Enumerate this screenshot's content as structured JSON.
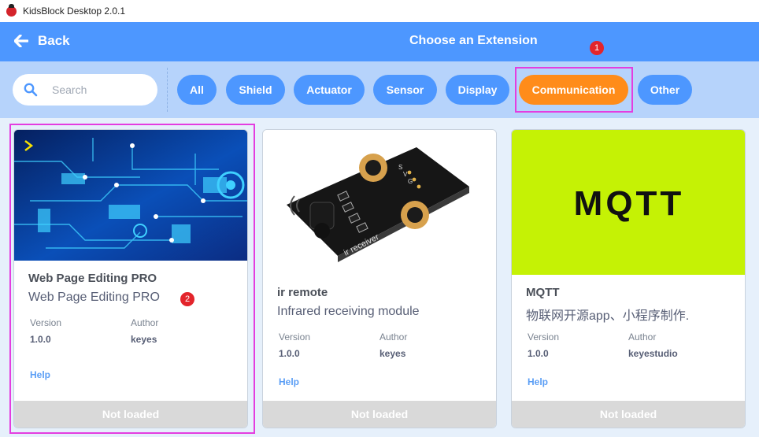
{
  "window": {
    "title": "KidsBlock Desktop 2.0.1"
  },
  "header": {
    "back_label": "Back",
    "title": "Choose an Extension"
  },
  "search": {
    "placeholder": "Search",
    "value": ""
  },
  "tags": [
    {
      "label": "All"
    },
    {
      "label": "Shield"
    },
    {
      "label": "Actuator"
    },
    {
      "label": "Sensor"
    },
    {
      "label": "Display"
    },
    {
      "label": "Communication",
      "active": true
    },
    {
      "label": "Other"
    }
  ],
  "annotations": [
    "1",
    "2"
  ],
  "meta_labels": {
    "version": "Version",
    "author": "Author",
    "help": "Help"
  },
  "cards": [
    {
      "name": "Web Page Editing PRO",
      "description": "Web Page Editing PRO",
      "version": "1.0.0",
      "author": "keyes",
      "status": "Not loaded",
      "image_text": ""
    },
    {
      "name": "ir remote",
      "description": "Infrared receiving module",
      "version": "1.0.0",
      "author": "keyes",
      "status": "Not loaded",
      "image_text": "ir receiver",
      "pin_labels": [
        "S",
        "V",
        "G"
      ]
    },
    {
      "name": "MQTT",
      "description": "物联网开源app、小程序制作.",
      "version": "1.0.0",
      "author": "keyestudio",
      "status": "Not loaded",
      "image_text": "MQTT"
    }
  ],
  "colors": {
    "accent": "#4d97ff",
    "active_tag": "#ff8c1a",
    "filterbar": "#b6d3fb",
    "highlight": "#e43de0",
    "badge": "#e3242b",
    "mqtt_bg": "#c5f205"
  }
}
